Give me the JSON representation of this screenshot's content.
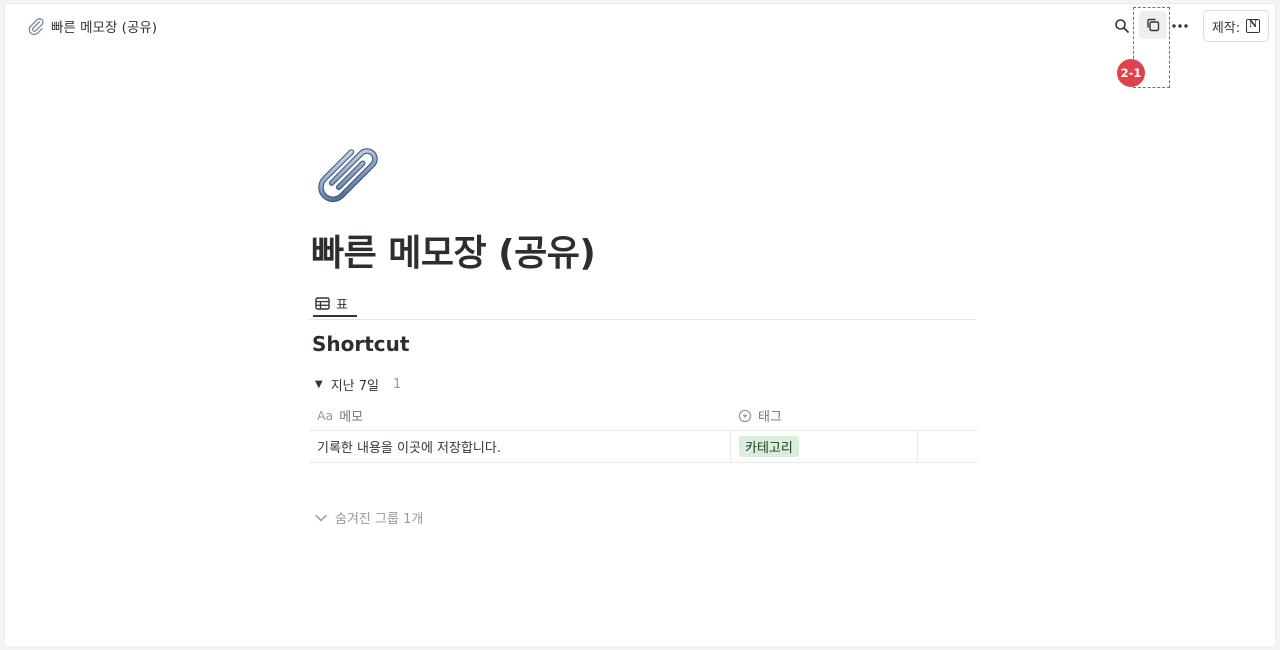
{
  "topbar": {
    "breadcrumb": "빠른 메모장 (공유)",
    "breadcrumb_icon": "paperclip-icon",
    "made_with_label": "제작:",
    "made_with_logo": "N",
    "icons": [
      "search-icon",
      "duplicate-icon",
      "more-icon",
      "notion-logo-icon"
    ]
  },
  "annotation": {
    "badge": "2-1",
    "color": "#e0424b"
  },
  "page": {
    "icon": "paperclip-icon",
    "title": "빠른 메모장 (공유)"
  },
  "view": {
    "tab_label": "표",
    "tab_icon": "table-icon"
  },
  "database": {
    "title": "Shortcut",
    "group": {
      "label": "지난 7일",
      "count": "1"
    },
    "columns": [
      {
        "prefix": "Aa",
        "label": "메모"
      },
      {
        "icon": "select-icon",
        "label": "태그"
      }
    ],
    "rows": [
      {
        "memo": "기록한 내용을 이곳에 저장합니다.",
        "tag": "카테고리"
      }
    ],
    "hidden_groups": "숨겨진 그룹 1개"
  },
  "colors": {
    "tag_bg": "#dbeddb",
    "text": "#37352f",
    "muted": "#9b9a97"
  }
}
